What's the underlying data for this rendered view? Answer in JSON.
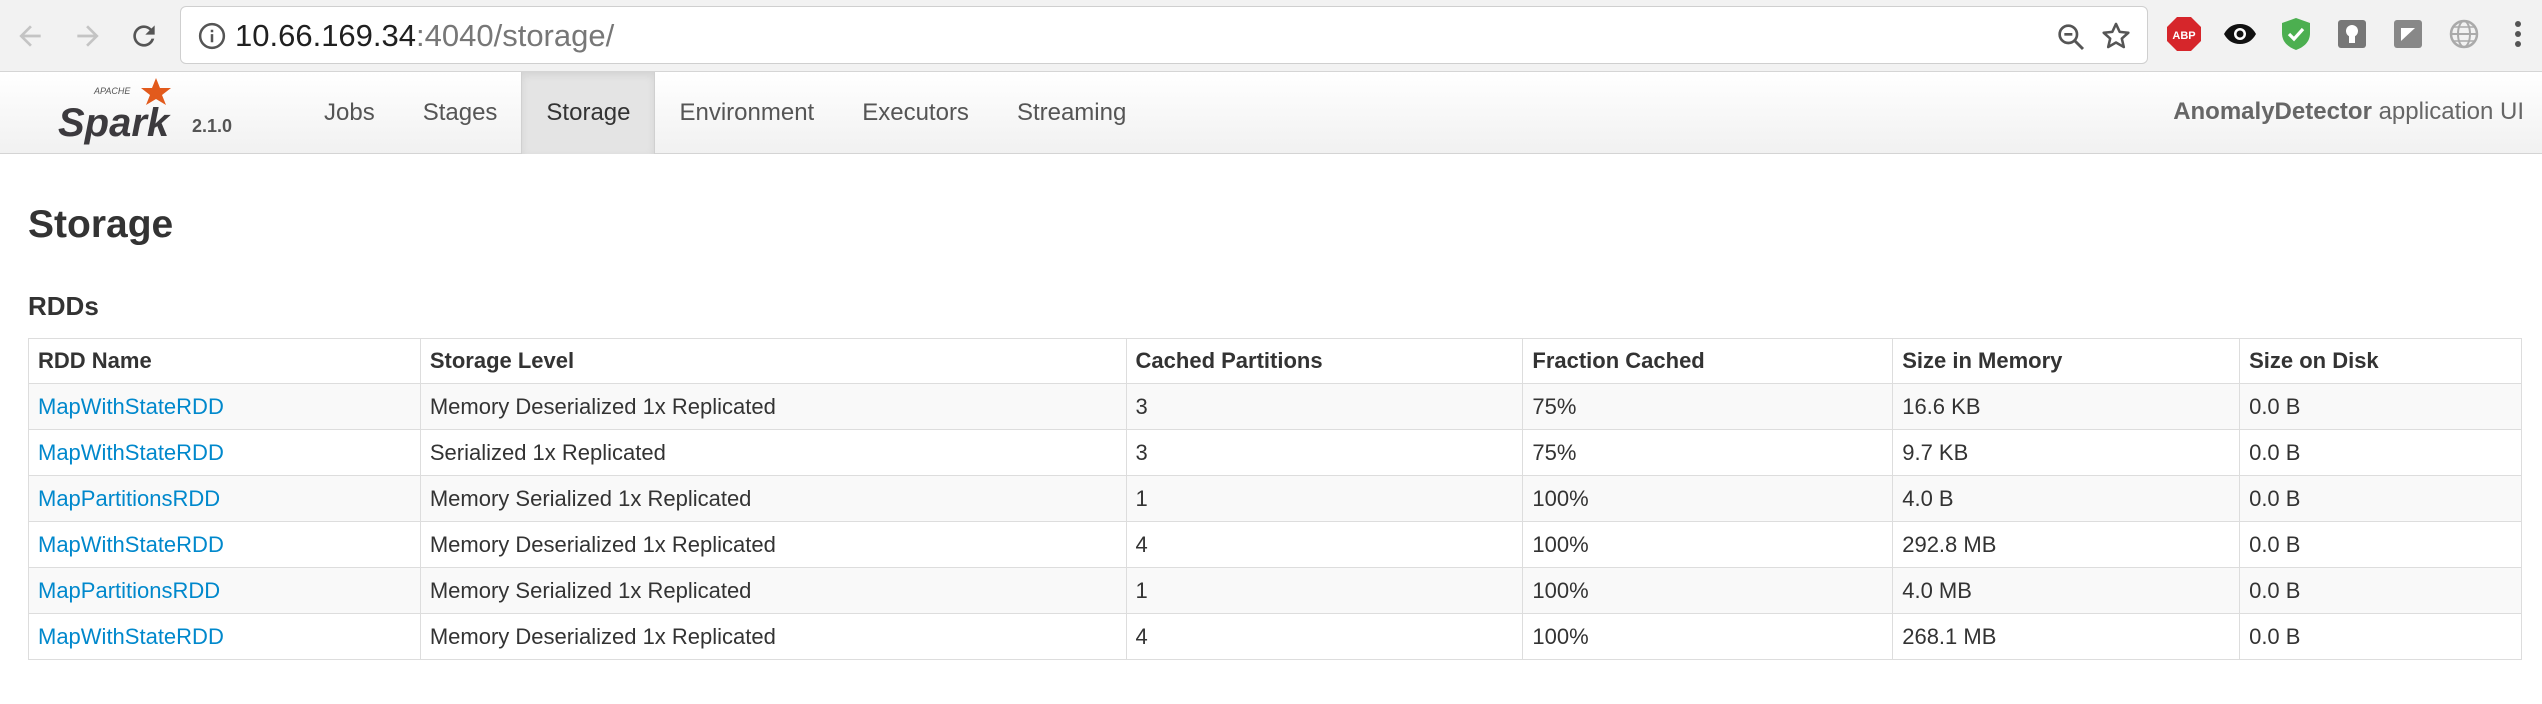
{
  "browser": {
    "url_host": "10.66.169.34",
    "url_rest": ":4040/storage/",
    "extensions": [
      {
        "name": "adblock-plus-icon",
        "label": "ABP",
        "color": "#d6262b"
      },
      {
        "name": "eye-icon",
        "color": "#111111"
      },
      {
        "name": "shield-check-icon",
        "color": "#4caf50"
      },
      {
        "name": "lightbulb-icon",
        "color": "#777777"
      },
      {
        "name": "square-note-icon",
        "color": "#888888"
      },
      {
        "name": "globe-icon",
        "color": "#aaaaaa"
      }
    ]
  },
  "navbar": {
    "logo_text": "Spark",
    "logo_apache": "APACHE",
    "version": "2.1.0",
    "tabs": [
      "Jobs",
      "Stages",
      "Storage",
      "Environment",
      "Executors",
      "Streaming"
    ],
    "active_tab": "Storage",
    "app_name": "AnomalyDetector",
    "app_suffix": " application UI"
  },
  "page": {
    "title": "Storage",
    "section_title": "RDDs"
  },
  "table": {
    "headers": [
      "RDD Name",
      "Storage Level",
      "Cached Partitions",
      "Fraction Cached",
      "Size in Memory",
      "Size on Disk"
    ],
    "rows": [
      [
        "MapWithStateRDD",
        "Memory Deserialized 1x Replicated",
        "3",
        "75%",
        "16.6 KB",
        "0.0 B"
      ],
      [
        "MapWithStateRDD",
        "Serialized 1x Replicated",
        "3",
        "75%",
        "9.7 KB",
        "0.0 B"
      ],
      [
        "MapPartitionsRDD",
        "Memory Serialized 1x Replicated",
        "1",
        "100%",
        "4.0 B",
        "0.0 B"
      ],
      [
        "MapWithStateRDD",
        "Memory Deserialized 1x Replicated",
        "4",
        "100%",
        "292.8 MB",
        "0.0 B"
      ],
      [
        "MapPartitionsRDD",
        "Memory Serialized 1x Replicated",
        "1",
        "100%",
        "4.0 MB",
        "0.0 B"
      ],
      [
        "MapWithStateRDD",
        "Memory Deserialized 1x Replicated",
        "4",
        "100%",
        "268.1 MB",
        "0.0 B"
      ]
    ]
  },
  "colors": {
    "link": "#0088cc",
    "spark_orange": "#e25a1c",
    "active_tab_bg": "#e4e4e4"
  }
}
